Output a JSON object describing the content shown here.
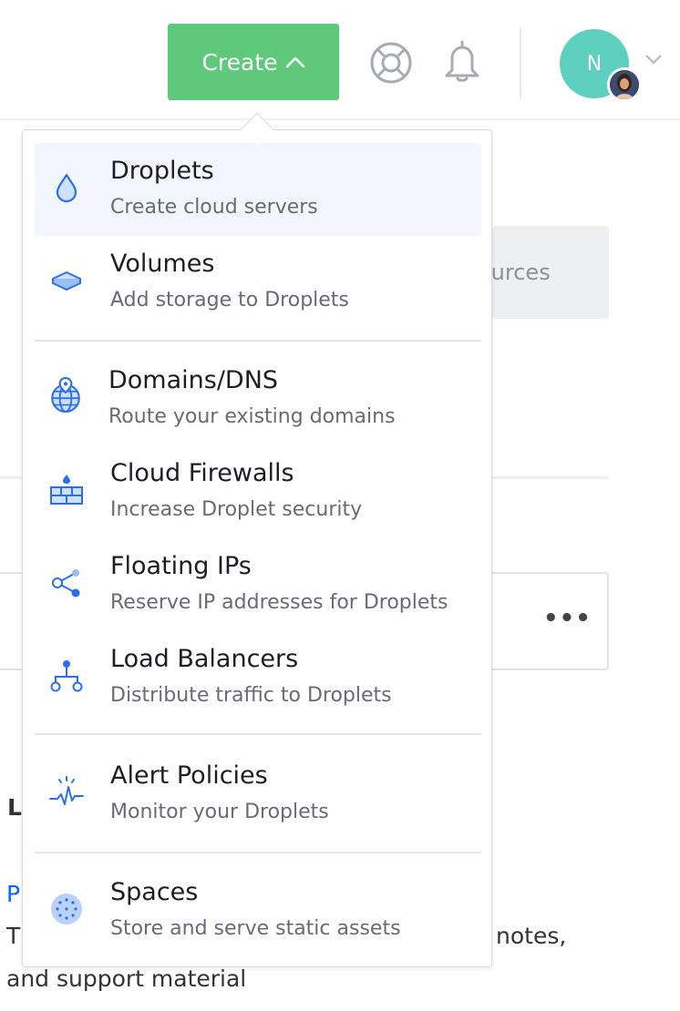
{
  "header": {
    "create_label": "Create",
    "avatar_initial": "N"
  },
  "background": {
    "tab_partial": "ources",
    "more_label": "•••",
    "letter_l": "L",
    "link_p": "P",
    "text_t": "T",
    "notes_partial": "notes,",
    "support_line": "and support material"
  },
  "menu": {
    "items": [
      {
        "title": "Droplets",
        "subtitle": "Create cloud servers",
        "icon": "droplet-icon"
      },
      {
        "title": "Volumes",
        "subtitle": "Add storage to Droplets",
        "icon": "volume-icon"
      },
      {
        "title": "Domains/DNS",
        "subtitle": "Route your existing domains",
        "icon": "globe-pin-icon"
      },
      {
        "title": "Cloud Firewalls",
        "subtitle": "Increase Droplet security",
        "icon": "firewall-icon"
      },
      {
        "title": "Floating IPs",
        "subtitle": "Reserve IP addresses for Droplets",
        "icon": "share-nodes-icon"
      },
      {
        "title": "Load Balancers",
        "subtitle": "Distribute traffic to Droplets",
        "icon": "load-balancer-icon"
      },
      {
        "title": "Alert Policies",
        "subtitle": "Monitor your Droplets",
        "icon": "pulse-icon"
      },
      {
        "title": "Spaces",
        "subtitle": "Store and serve static assets",
        "icon": "spaces-icon"
      }
    ]
  },
  "colors": {
    "create_button": "#5ec97a",
    "accent_blue": "#0069ff",
    "avatar": "#5dd0c0",
    "active_row": "#f3f7fd"
  }
}
